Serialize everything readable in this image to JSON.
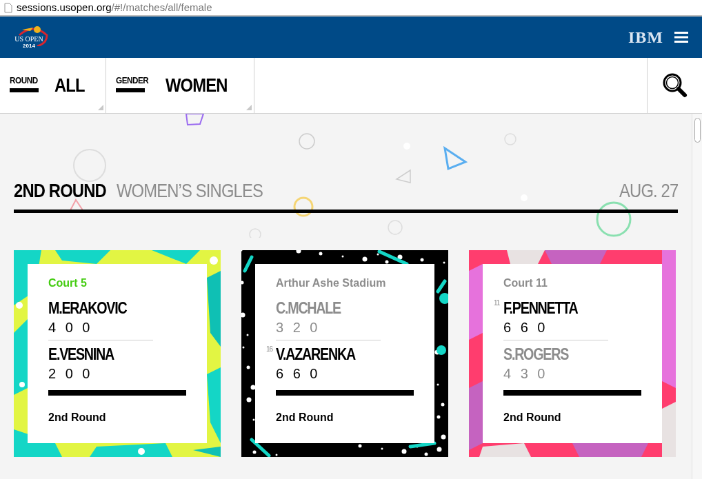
{
  "address_bar": {
    "url_host": "sessions.usopen.org",
    "url_path": "/#!/matches/all/female"
  },
  "header": {
    "logo_text": "US OPEN",
    "logo_year": "2014",
    "partner": "IBM"
  },
  "filters": [
    {
      "label": "ROUND",
      "value": "ALL"
    },
    {
      "label": "GENDER",
      "value": "WOMEN"
    }
  ],
  "section": {
    "round": "2ND ROUND",
    "event": "WOMEN’S SINGLES",
    "date": "AUG. 27"
  },
  "matches": [
    {
      "kind": "shards",
      "court": "Court 5",
      "color": "#44cc11",
      "round": "2nd Round",
      "players": [
        {
          "name": "M.ERAKOVIC",
          "scores": "4 0 0",
          "winner": true
        },
        {
          "name": "E.VESNINA",
          "scores": "2 0 0",
          "winner": true
        }
      ]
    },
    {
      "kind": "speckle",
      "court": "Arthur Ashe Stadium",
      "color": "#8c8c8c",
      "round": "2nd Round",
      "players": [
        {
          "name": "C.MCHALE",
          "scores": "3 2 0",
          "winner": false
        },
        {
          "seed": "16",
          "name": "V.AZARENKA",
          "scores": "6 6 0",
          "winner": true
        }
      ]
    },
    {
      "kind": "cubes",
      "court": "Court 11",
      "color": "#8c8c8c",
      "round": "2nd Round",
      "players": [
        {
          "seed": "11",
          "name": "F.PENNETTA",
          "scores": "6 6 0",
          "winner": true
        },
        {
          "name": "S.ROGERS",
          "scores": "4 3 0",
          "winner": false
        }
      ]
    }
  ]
}
